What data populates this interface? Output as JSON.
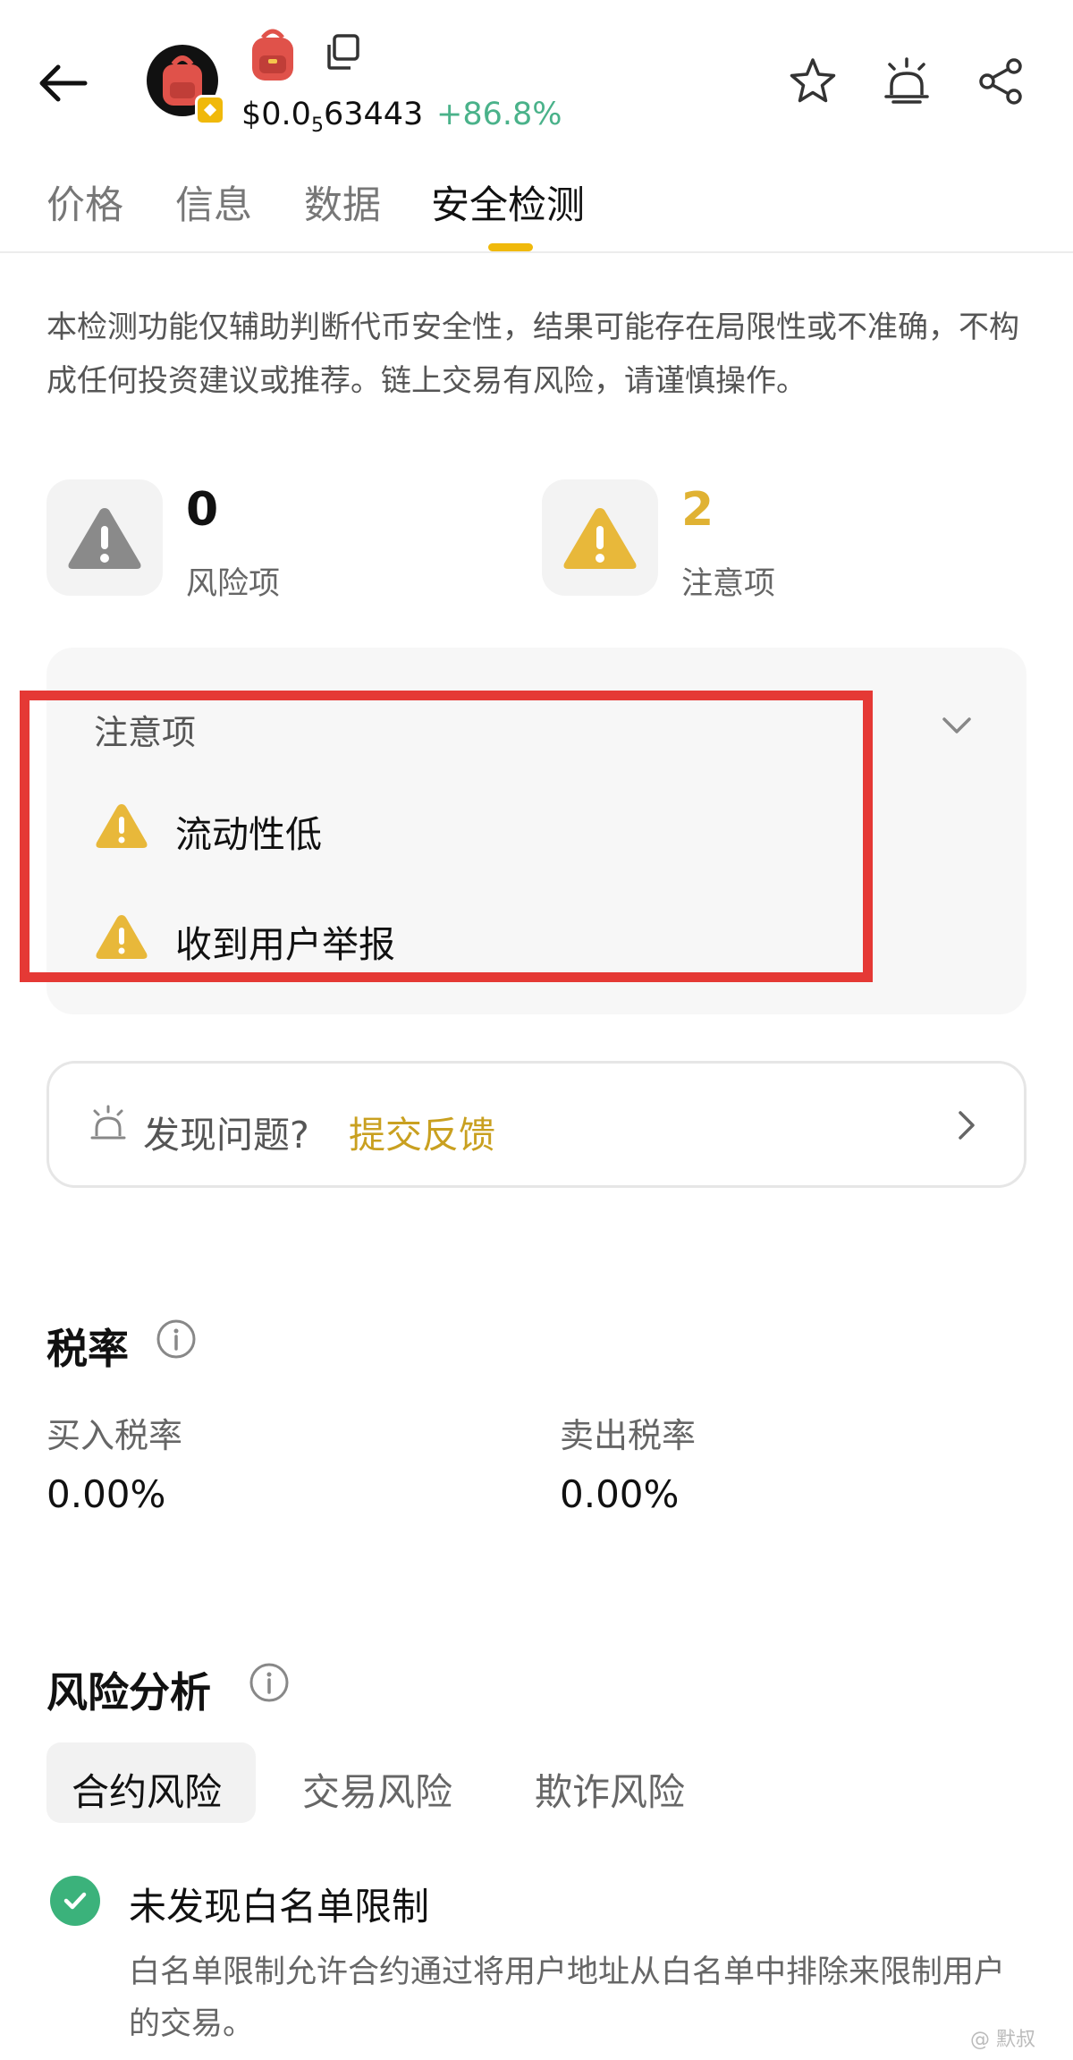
{
  "header": {
    "price_prefix": "$0.0",
    "price_subscript": "5",
    "price_suffix": "63443",
    "change": "+86.8%",
    "change_color": "#4ab28a",
    "icons": [
      "back-arrow-icon",
      "copy-icon",
      "star-icon",
      "alert-bell-icon",
      "share-icon"
    ]
  },
  "tabs": [
    {
      "label": "价格",
      "active": false
    },
    {
      "label": "信息",
      "active": false
    },
    {
      "label": "数据",
      "active": false
    },
    {
      "label": "安全检测",
      "active": true
    }
  ],
  "accent_color": "#f0b90b",
  "disclaimer": "本检测功能仅辅助判断代币安全性，结果可能存在局限性或不准确，不构成任何投资建议或推荐。链上交易有风险，请谨慎操作。",
  "summary": {
    "risk": {
      "count": "0",
      "label": "风险项"
    },
    "attention": {
      "count": "2",
      "label": "注意项"
    }
  },
  "attention_card": {
    "title": "注意项",
    "items": [
      {
        "text": "流动性低"
      },
      {
        "text": "收到用户举报"
      }
    ]
  },
  "highlight_color": "#e53935",
  "feedback": {
    "question": "发现问题?",
    "link": "提交反馈"
  },
  "tax": {
    "title": "税率",
    "buy_label": "买入税率",
    "buy_value": "0.00%",
    "sell_label": "卖出税率",
    "sell_value": "0.00%"
  },
  "risk_analysis": {
    "title": "风险分析",
    "tabs": [
      {
        "label": "合约风险",
        "active": true
      },
      {
        "label": "交易风险",
        "active": false
      },
      {
        "label": "欺诈风险",
        "active": false
      }
    ],
    "items": [
      {
        "title": "未发现白名单限制",
        "desc": "白名单限制允许合约通过将用户地址从白名单中排除来限制用户的交易。",
        "status_color": "#3bb27b"
      }
    ]
  },
  "watermark": "@ 默叔"
}
